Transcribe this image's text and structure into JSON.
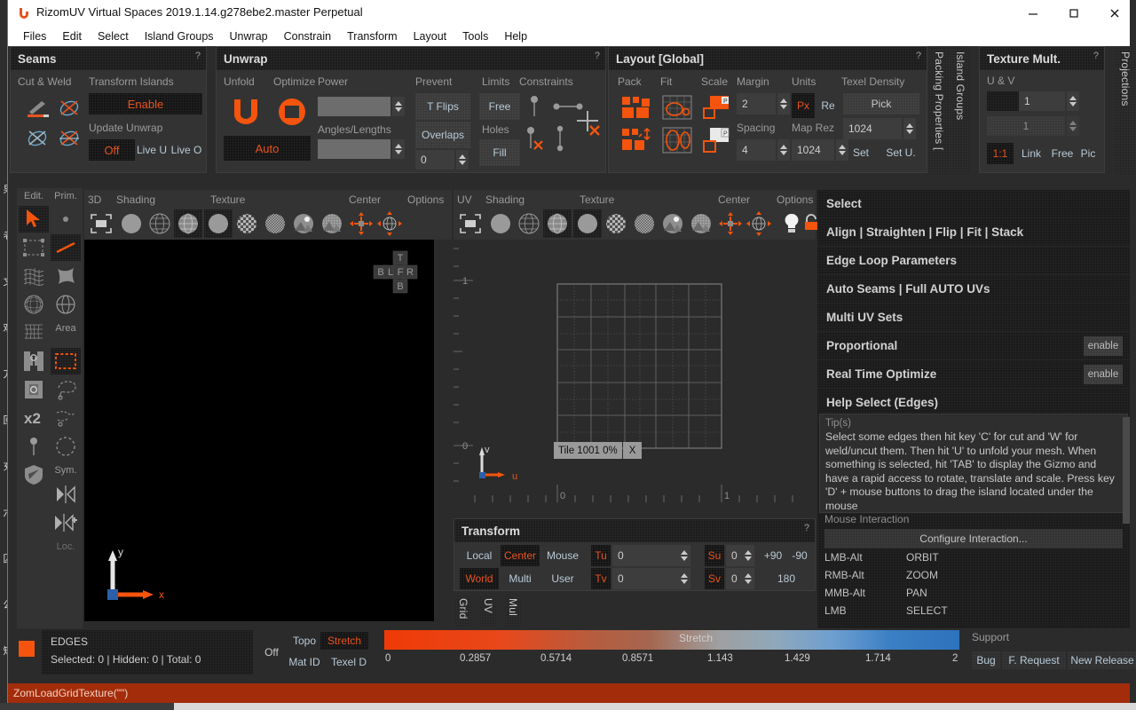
{
  "window": {
    "title": "RizomUV  Virtual Spaces 2019.1.14.g278ebe2.master Perpetual",
    "minimize": "—",
    "maximize": "☐",
    "close": "✕"
  },
  "menubar": {
    "items": [
      "Files",
      "Edit",
      "Select",
      "Island Groups",
      "Unwrap",
      "Constrain",
      "Transform",
      "Layout",
      "Tools",
      "Help"
    ]
  },
  "background_strip": {
    "chars": [
      "果",
      "老",
      "文",
      "欢",
      "刀",
      "回",
      "充",
      "六",
      "囚",
      "公",
      "短"
    ]
  },
  "seams": {
    "title": "Seams",
    "help": "?",
    "group_cut_weld": "Cut & Weld",
    "group_transform_islands": "Transform Islands",
    "enable_label": "Enable",
    "group_update_unwrap": "Update Unwrap",
    "update_modes": [
      "Off",
      "Live U",
      "Live O"
    ],
    "update_selected": "Off",
    "icons": [
      "cut-seam-icon",
      "weld-seam-icon",
      "uncut-seam-icon",
      "cut-cross-seam-icon"
    ]
  },
  "unwrap": {
    "title": "Unwrap",
    "help": "?",
    "col_unfold": "Unfold",
    "col_optimize": "Optimize",
    "col_power": "Power",
    "col_prevent": "Prevent",
    "col_limits": "Limits",
    "col_constraints": "Constraints",
    "auto_label": "Auto",
    "angles_lengths": "Angles/Lengths",
    "tflips_label": "T Flips",
    "overlaps_label": "Overlaps",
    "overlaps_value": "0",
    "free_label": "Free",
    "holes_label": "Holes",
    "fill_label": "Fill",
    "power_value": "",
    "angles_value": ""
  },
  "layout": {
    "title": "Layout [Global]",
    "help": "?",
    "col_pack": "Pack",
    "col_fit": "Fit",
    "col_scale": "Scale",
    "col_margin": "Margin",
    "col_units": "Units",
    "col_texel": "Texel Density",
    "margin_value": "2",
    "spacing_label": "Spacing",
    "spacing_value": "4",
    "units_px": "Px",
    "units_re": "Re",
    "maprez_label": "Map Rez",
    "maprez_value": "1024",
    "texel_pick": "Pick",
    "texel_value": "1024",
    "texel_set": "Set",
    "texel_setu": "Set U."
  },
  "texture_mult": {
    "title": "Texture Mult.",
    "help": "?",
    "uv_label": "U & V",
    "value_u": "1",
    "value_v": "1",
    "modes": [
      "1:1",
      "Link",
      "Free",
      "Pic"
    ],
    "mode_selected": "1:1"
  },
  "vtabs": {
    "packing_properties": "Packing Properties [",
    "island_groups": "Island Groups",
    "projections": "Projections"
  },
  "lefttools": {
    "col_edit": "Edit.",
    "col_prim": "Prim.",
    "area_label": "Area",
    "sym_label": "Sym.",
    "loc_label": "Loc.",
    "edit_icons": [
      "select-arrow-icon",
      "box-select-icon",
      "mesh-wave-icon",
      "globe-grid-icon",
      "plane-grid-icon",
      "flatten-left-icon",
      "flatten-center-icon",
      "x2-icon",
      "pin-icon",
      "shield-icon"
    ],
    "prim_icons": [
      "vertex-dot-icon",
      "edge-line-icon",
      "polygon-icon",
      "sphere-icon",
      "area-rect-icon",
      "lasso-icon",
      "paint-select-icon",
      "circle-select-icon",
      "sym-mirror-icon",
      "sym-mirror-move-icon"
    ]
  },
  "viewport3d": {
    "label": "3D",
    "shading_label": "Shading",
    "texture_label": "Texture",
    "center_label": "Center",
    "options_label": "Options",
    "viewcube": {
      "top": "T",
      "bottom": "B",
      "left": "B",
      "mid_left": "L",
      "front": "F",
      "right": "R"
    },
    "axis": {
      "y": "y",
      "x": "x"
    }
  },
  "viewportuv": {
    "label": "UV",
    "shading_label": "Shading",
    "texture_label": "Texture",
    "center_label": "Center",
    "options_label": "Options",
    "tile_badge": "Tile 1001 0%",
    "tile_close": "X",
    "axis": {
      "v": "v",
      "u": "u"
    },
    "ruler_v": [
      "1",
      "0"
    ],
    "ruler_u": [
      "0",
      "1"
    ]
  },
  "select_panel": {
    "rows": [
      {
        "label": "Select",
        "enable": ""
      },
      {
        "label": "Align | Straighten | Flip | Fit | Stack",
        "enable": ""
      },
      {
        "label": "Edge Loop Parameters",
        "enable": ""
      },
      {
        "label": "Auto Seams | Full AUTO UVs",
        "enable": ""
      },
      {
        "label": "Multi UV Sets",
        "enable": ""
      },
      {
        "label": "Proportional",
        "enable": "enable"
      },
      {
        "label": "Real Time Optimize",
        "enable": "enable"
      },
      {
        "label": "Help Select (Edges)",
        "enable": ""
      }
    ],
    "tips_label": "Tip(s)",
    "tips_text": "Select some edges then hit key 'C' for cut and 'W' for weld/uncut them. Then hit 'U' to unfold your mesh. When something is selected, hit 'TAB' to display the Gizmo and have a rapid access to rotate, translate and scale. Press key 'D' + mouse buttons to drag the island located under the mouse",
    "mouse_label": "Mouse Interaction",
    "configure": "Configure Interaction...",
    "bindings": [
      {
        "key": "LMB-Alt",
        "action": "ORBIT"
      },
      {
        "key": "RMB-Alt",
        "action": "ZOOM"
      },
      {
        "key": "MMB-Alt",
        "action": "PAN"
      },
      {
        "key": "LMB",
        "action": "SELECT"
      }
    ]
  },
  "transform": {
    "title": "Transform",
    "help": "?",
    "space_modes": [
      "Local",
      "World"
    ],
    "space_selected": "World",
    "pivot_modes": [
      "Center",
      "Multi"
    ],
    "pivot_selected": "Center",
    "target_modes": [
      "Mouse",
      "User"
    ],
    "tu_label": "Tu",
    "tu_value": "0",
    "tv_label": "Tv",
    "tv_value": "0",
    "su_label": "Su",
    "su_value": "0",
    "sv_label": "Sv",
    "sv_value": "0",
    "rot_plus90": "+90",
    "rot_minus90": "-90",
    "rot_180": "180",
    "bottom_tabs": [
      "Grid",
      "UV",
      "Mul"
    ]
  },
  "statusbar": {
    "mode": "EDGES",
    "counts": "Selected: 0 | Hidden: 0 | Total: 0",
    "off_label": "Off",
    "topo_label": "Topo",
    "stretch_label": "Stretch",
    "matid_label": "Mat ID",
    "texeld_label": "Texel D",
    "color_swatch": "#f4540d",
    "scale_title": "Stretch",
    "scale_ticks": [
      "0",
      "0.2857",
      "0.5714",
      "0.8571",
      "1.143",
      "1.429",
      "1.714",
      "2"
    ],
    "support_label": "Support",
    "support_links": [
      "Bug",
      "F. Request",
      "New Release"
    ],
    "command_line": "ZomLoadGridTexture(\"\")"
  },
  "colors": {
    "accent": "#e8531f",
    "panel_bg": "#333333",
    "panel_title_bg": "#1c1c1c",
    "text": "#c8c8c8",
    "status_cmd_bg": "#a32c0a"
  }
}
